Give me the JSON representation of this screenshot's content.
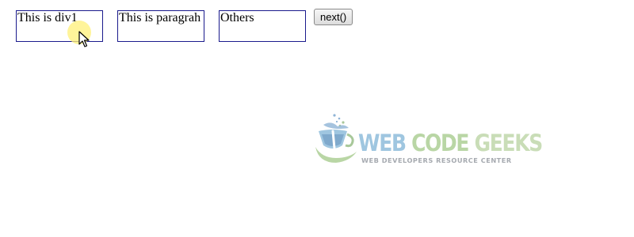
{
  "demo": {
    "div1_text": "This is div1",
    "paragraph_text": "This is paragrah",
    "others_text": "Others",
    "next_button_label": "next()"
  },
  "watermark": {
    "title_word1": "WEB",
    "title_word2": "CODE",
    "title_word3": "GEEKS",
    "tagline": "WEB DEVELOPERS RESOURCE CENTER"
  },
  "colors": {
    "box_border": "#1a1a8c",
    "logo_blue": "#9fc6e0",
    "logo_green": "#b9d6a5",
    "cursor_highlight": "#fff078"
  },
  "icons": {
    "cursor": "mouse-pointer-icon",
    "logo_mark": "web-code-geeks-logo-icon"
  }
}
